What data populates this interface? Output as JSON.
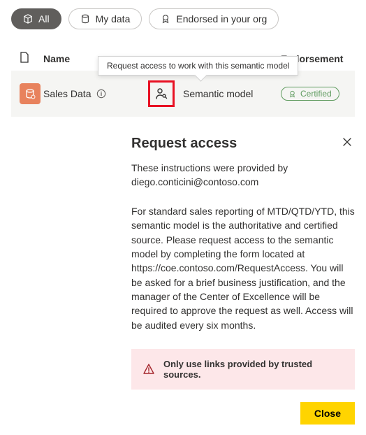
{
  "filters": {
    "all": "All",
    "my_data": "My data",
    "endorsed": "Endorsed in your org"
  },
  "columns": {
    "name": "Name",
    "endorsement": "Endorsement"
  },
  "tooltip": "Request access to work with this semantic model",
  "row": {
    "name": "Sales Data",
    "type": "Semantic model",
    "badge": "Certified"
  },
  "panel": {
    "title": "Request access",
    "provided_by_line": "These instructions were provided by diego.conticini@contoso.com",
    "body": "For standard sales reporting of MTD/QTD/YTD, this semantic model is the authoritative and certified source. Please request access to the semantic model by completing the form located at https://coe.contoso.com/RequestAccess. You will be asked for a brief business justification, and the manager of the Center of Excellence will be required to approve the request as well. Access will be audited every six months.",
    "warning": "Only use links provided by trusted sources.",
    "close_label": "Close"
  }
}
